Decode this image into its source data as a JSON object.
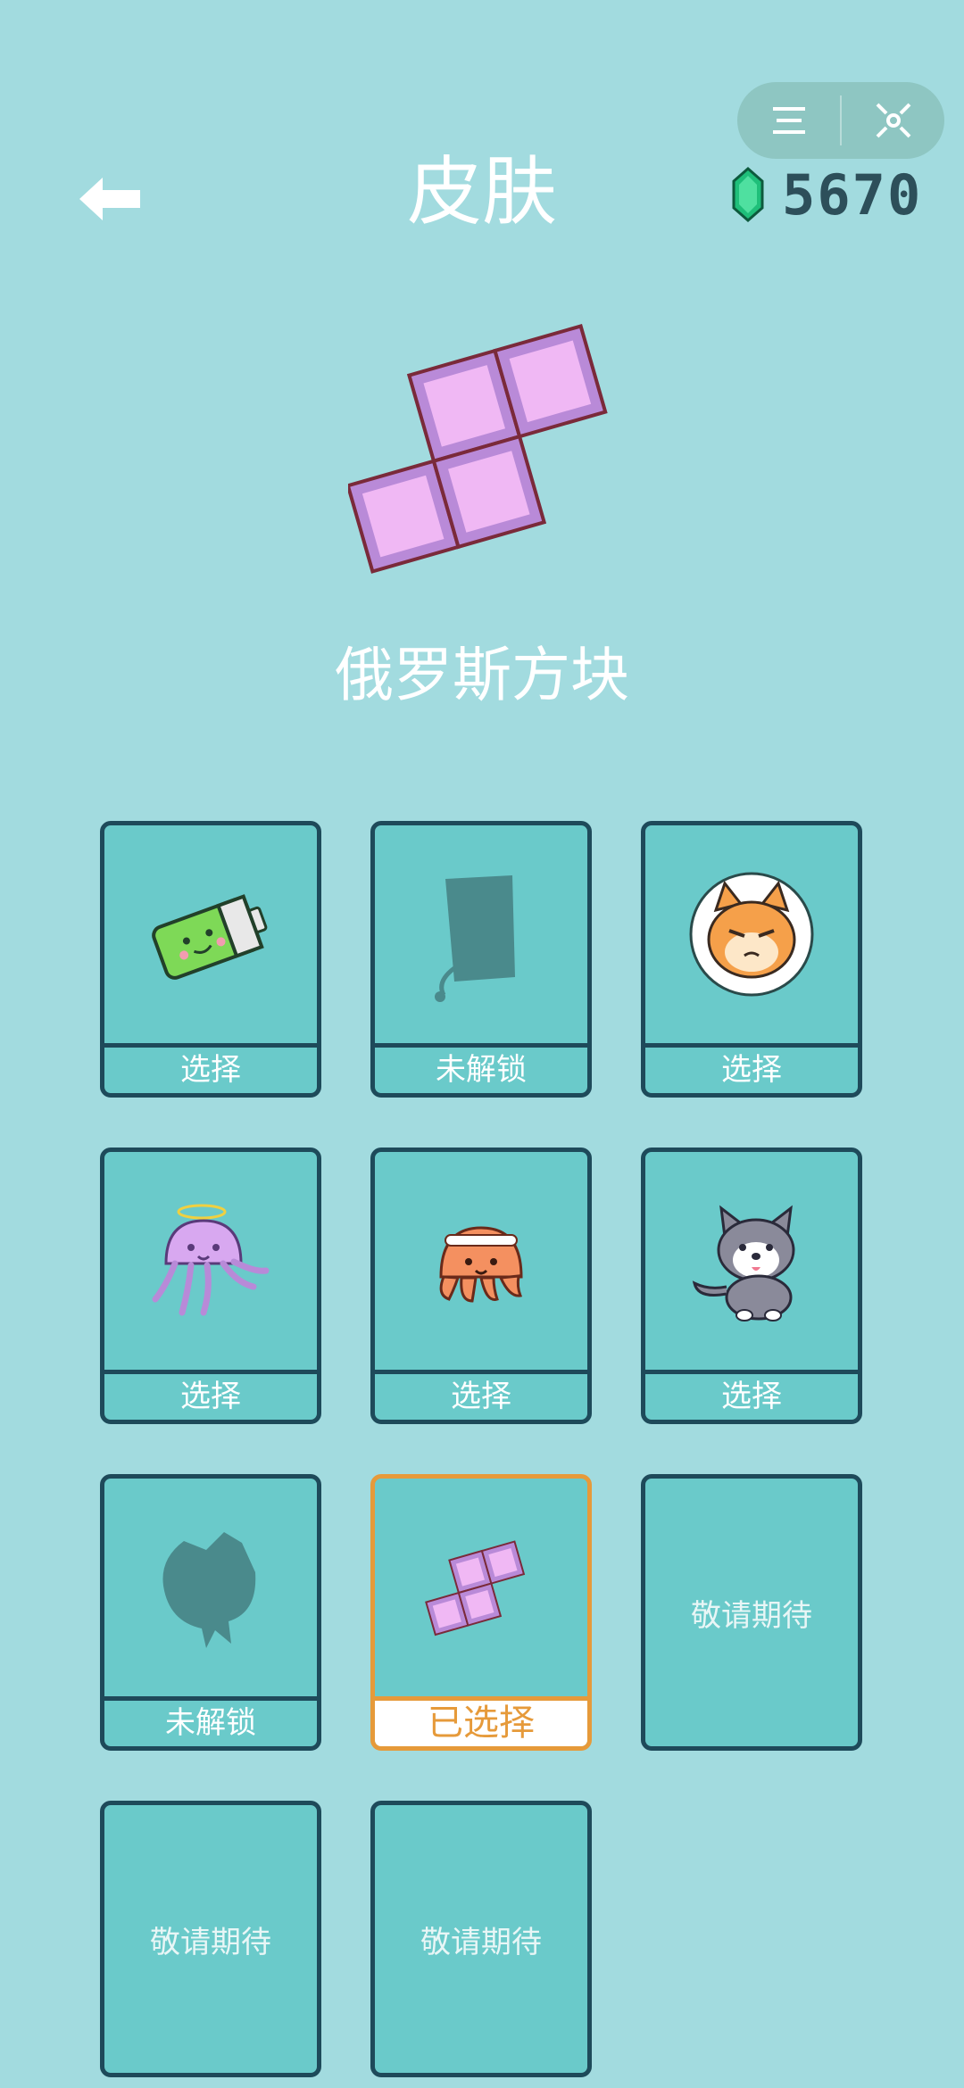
{
  "header": {
    "title": "皮肤",
    "currency_value": "5670",
    "menu_icon": "menu-icon",
    "close_icon": "close-icon",
    "back_icon": "back-arrow-icon",
    "gem_icon": "gem-icon"
  },
  "preview": {
    "name": "俄罗斯方块"
  },
  "skins": [
    {
      "label": "选择",
      "art": "battery"
    },
    {
      "label": "未解锁",
      "art": "locked-bag"
    },
    {
      "label": "选择",
      "art": "cat"
    },
    {
      "label": "选择",
      "art": "jellyfish"
    },
    {
      "label": "选择",
      "art": "octopus"
    },
    {
      "label": "选择",
      "art": "husky"
    },
    {
      "label": "未解锁",
      "art": "locked-creature"
    },
    {
      "label": "已选择",
      "art": "tetris"
    },
    {
      "soon": "敬请期待"
    },
    {
      "soon": "敬请期待"
    },
    {
      "soon": "敬请期待"
    }
  ],
  "colors": {
    "background": "#a2dbdf",
    "card": "#6acaca",
    "card_border": "#1e4a5a",
    "selected": "#e69a3a",
    "tetris_fill": "#f0b8f4",
    "tetris_frame": "#b98ad8"
  }
}
